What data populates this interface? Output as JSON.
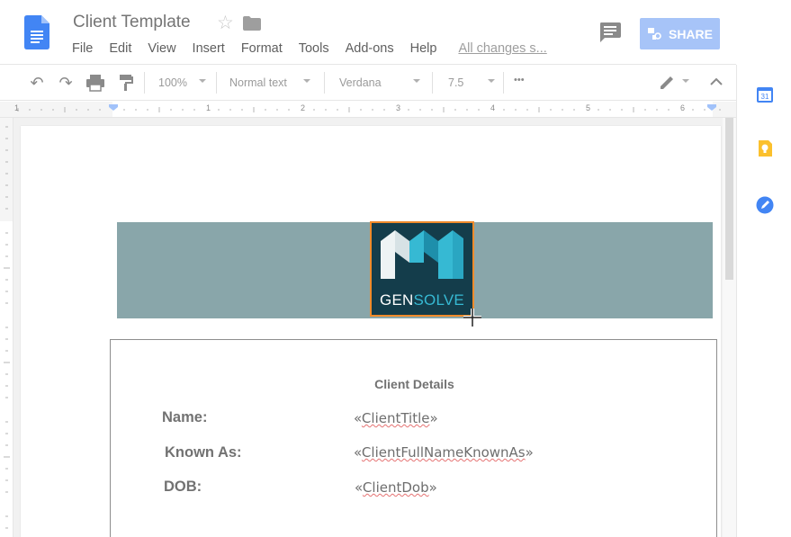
{
  "doc": {
    "title": "Client Template",
    "saved_status": "All changes s..."
  },
  "menu": [
    "File",
    "Edit",
    "View",
    "Insert",
    "Format",
    "Tools",
    "Add-ons",
    "Help"
  ],
  "share": {
    "label": "SHARE",
    "color": "#a7c4f8"
  },
  "toolbar": {
    "zoom": "100%",
    "style": "Normal text",
    "font": "Verdana",
    "size": "7.5",
    "more": "•••"
  },
  "ruler": {
    "numbers": [
      "1",
      "1",
      "2",
      "3",
      "4",
      "5",
      "6"
    ]
  },
  "logo": {
    "text_gen": "GEN",
    "text_solve": "SOLVE",
    "colors": {
      "bg": "#143d4b",
      "accent": "#36b9d3",
      "border": "#f08b2b"
    }
  },
  "details": {
    "title": "Client Details",
    "rows": [
      {
        "label": "Name:",
        "open": "«",
        "value": "ClientTitle",
        "close": "»"
      },
      {
        "label": "Known As:",
        "open": "«",
        "value": "ClientFullNameKnownAs",
        "close": "»"
      },
      {
        "label": "DOB:",
        "open": "«",
        "value": "ClientDob",
        "close": "»"
      }
    ]
  },
  "side_panel": {
    "calendar_day": "31",
    "icons": [
      "calendar-icon",
      "keep-icon",
      "tasks-icon"
    ]
  },
  "colors": {
    "banner": "#89a6aa",
    "header_icon": "#4285f4"
  }
}
